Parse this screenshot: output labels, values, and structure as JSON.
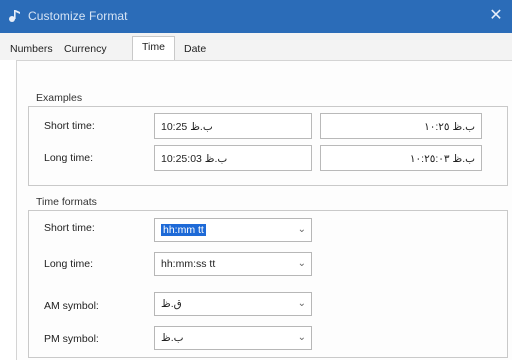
{
  "window": {
    "title": "Customize Format",
    "close_glyph": "✕",
    "icon": "music-note-icon"
  },
  "tabs": [
    {
      "label": "Numbers",
      "active": false
    },
    {
      "label": "Currency",
      "active": false
    },
    {
      "label": "Time",
      "active": true
    },
    {
      "label": "Date",
      "active": false
    }
  ],
  "examples": {
    "title": "Examples",
    "short_label": "Short time:",
    "long_label": "Long time:",
    "short_latin": "10:25 ب.ظ",
    "short_arabic": "ب.ظ ١٠:٢٥",
    "long_latin": "10:25:03 ب.ظ",
    "long_arabic": "ب.ظ ١٠:٢٥:٠٣"
  },
  "formats": {
    "title": "Time formats",
    "short_label": "Short time:",
    "short_value": "hh:mm tt",
    "long_label": "Long time:",
    "long_value": "hh:mm:ss tt",
    "am_label": "AM symbol:",
    "am_value": "ق.ظ",
    "pm_label": "PM symbol:",
    "pm_value": "ب.ظ"
  },
  "colors": {
    "titlebar": "#2b6cb8",
    "selection": "#1e6ad7"
  }
}
